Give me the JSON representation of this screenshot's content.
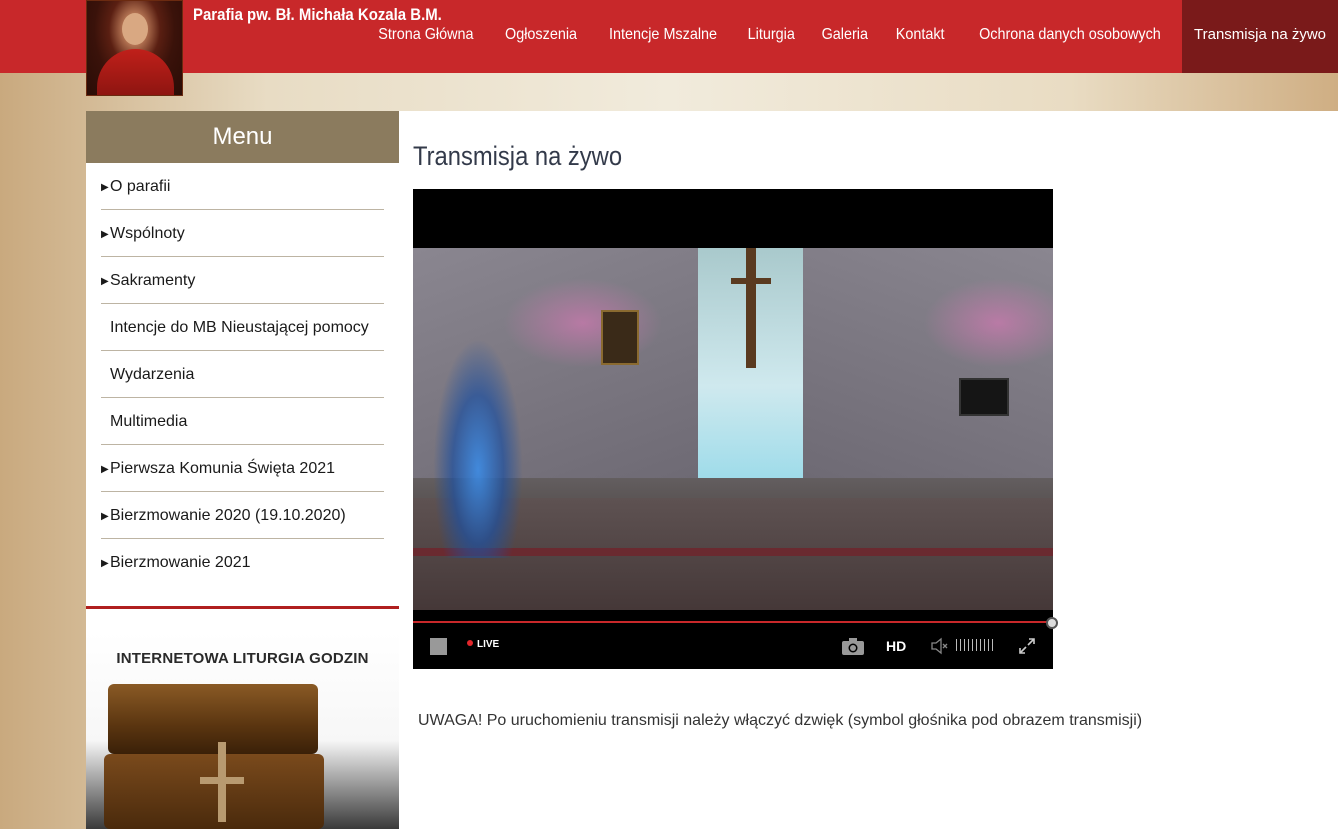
{
  "header": {
    "site_title": "Parafia pw. Bł. Michała Kozala B.M.",
    "nav": [
      {
        "label": "Strona Główna"
      },
      {
        "label": "Ogłoszenia"
      },
      {
        "label": "Intencje Mszalne"
      },
      {
        "label": "Liturgia"
      },
      {
        "label": "Galeria"
      },
      {
        "label": "Kontakt"
      },
      {
        "label": "Ochrona danych osobowych"
      },
      {
        "label": "Transmisja na żywo",
        "active": true
      }
    ]
  },
  "sidebar": {
    "menu_title": "Menu",
    "items": [
      {
        "label": "O parafii",
        "has_submenu": true
      },
      {
        "label": "Wspólnoty",
        "has_submenu": true
      },
      {
        "label": "Sakramenty",
        "has_submenu": true
      },
      {
        "label": "Intencje do MB Nieustającej pomocy",
        "has_submenu": false
      },
      {
        "label": "Wydarzenia",
        "has_submenu": false
      },
      {
        "label": "Multimedia",
        "has_submenu": false
      },
      {
        "label": "Pierwsza Komunia Święta 2021",
        "has_submenu": true
      },
      {
        "label": "Bierzmowanie 2020 (19.10.2020)",
        "has_submenu": true
      },
      {
        "label": "Bierzmowanie 2021",
        "has_submenu": true
      }
    ],
    "banner_text": "INTERNETOWA LITURGIA GODZIN"
  },
  "main": {
    "page_title": "Transmisja na żywo",
    "player": {
      "live_label": "LIVE",
      "quality_label": "HD",
      "icons": [
        "stop-icon",
        "camera-icon",
        "volume-icon",
        "fullscreen-icon"
      ]
    },
    "notice": "UWAGA! Po uruchomieniu transmisji należy włączyć dzwięk (symbol głośnika pod obrazem transmisji)"
  },
  "colors": {
    "header_red": "#c8282a",
    "active_nav": "#7a1a1a",
    "menu_head": "#8b7b5e",
    "divider_red": "#b01f1f"
  }
}
